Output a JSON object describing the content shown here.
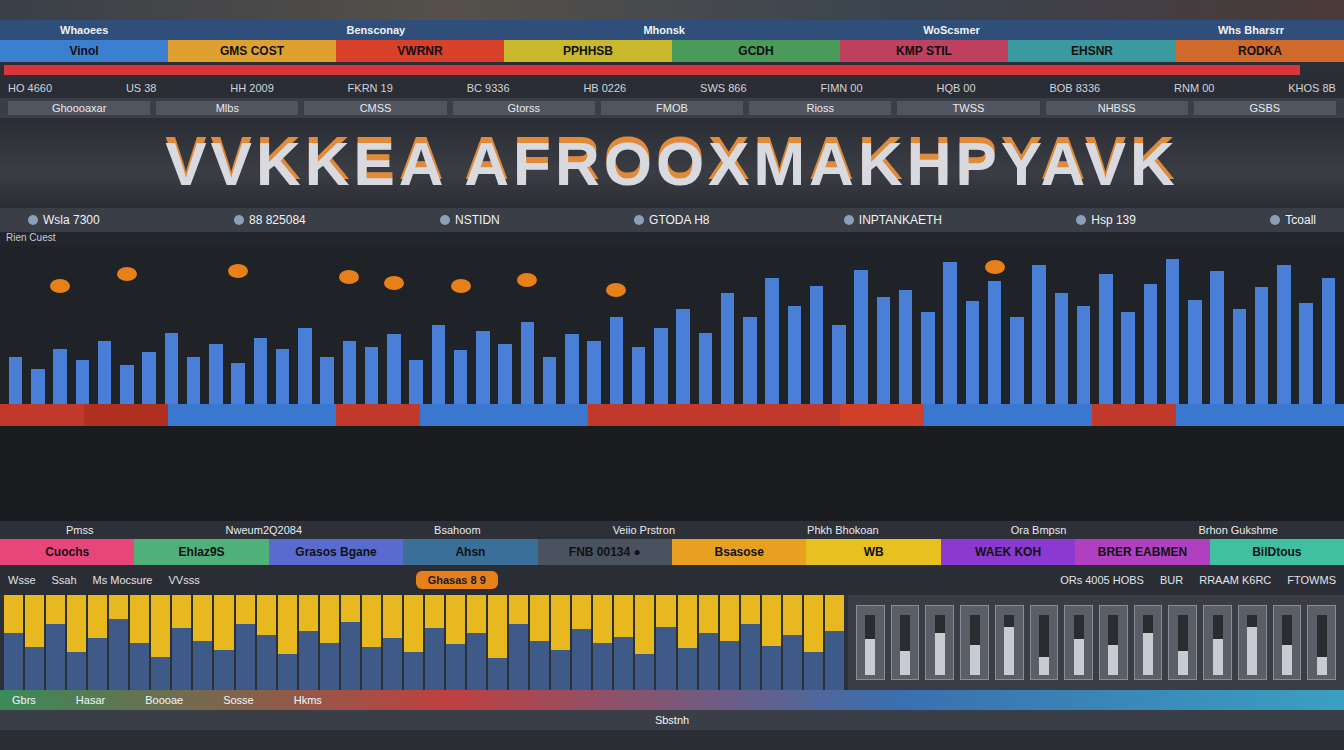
{
  "header": {
    "items": [
      "Whaoees",
      "Bensconay",
      "Mhonsk",
      "WoScsmer",
      "Whs Bharsrr"
    ]
  },
  "segments": [
    {
      "label": "Vinol",
      "color": "#3b7fd0"
    },
    {
      "label": "GMS COST",
      "color": "#e0a030"
    },
    {
      "label": "VWRNR",
      "color": "#d8402a"
    },
    {
      "label": "PPHHSB",
      "color": "#c9b82c"
    },
    {
      "label": "GCDH",
      "color": "#4a9a5a"
    },
    {
      "label": "KMP STIL",
      "color": "#c04060"
    },
    {
      "label": "EHSNR",
      "color": "#3a9aa0"
    },
    {
      "label": "RODKA",
      "color": "#d06a2a"
    }
  ],
  "progress": {
    "level": 0.97
  },
  "ticker": [
    "HO 4660",
    "US 38",
    "HH 2009",
    "FKRN 19",
    "BC 9336",
    "HB 0226",
    "SWS 866",
    "FIMN 00",
    "HQB 00",
    "BOB 8336",
    "RNM 00",
    "KHOS 8B"
  ],
  "toolbar": [
    "Ghoooaxar",
    "Mlbs",
    "CMSS",
    "Gtorss",
    "FMOB",
    "Rioss",
    "TWSS",
    "NHBSS",
    "GSBS"
  ],
  "banner": {
    "title": "VVKKEA AFROOXMAKHPYAVK"
  },
  "info": [
    "Wsla 7300",
    "88 825084",
    "NSTIDN",
    "GTODA H8",
    "INPTANKAETH",
    "Hsp 139",
    "Tcoall"
  ],
  "chart": {
    "label": "Rien Cuest",
    "bars": [
      30,
      22,
      35,
      28,
      40,
      25,
      33,
      45,
      30,
      38,
      26,
      42,
      35,
      48,
      30,
      40,
      36,
      44,
      28,
      50,
      34,
      46,
      38,
      52,
      30,
      44,
      40,
      55,
      36,
      48,
      60,
      45,
      70,
      55,
      80,
      62,
      75,
      50,
      85,
      68,
      72,
      58,
      90,
      65,
      78,
      55,
      88,
      70,
      62,
      82,
      58,
      76,
      92,
      66,
      84,
      60,
      74,
      88,
      64,
      80
    ],
    "peaks": [
      0,
      0,
      70,
      0,
      0,
      78,
      0,
      0,
      0,
      0,
      80,
      0,
      0,
      0,
      0,
      76,
      0,
      72,
      0,
      0,
      70,
      0,
      0,
      74,
      0,
      0,
      0,
      68,
      0,
      0,
      0,
      0,
      0,
      0,
      0,
      0,
      0,
      0,
      0,
      0,
      0,
      0,
      0,
      0,
      82,
      0,
      0,
      0,
      0,
      0,
      0,
      0,
      0,
      0,
      0,
      0,
      0,
      0,
      0,
      0
    ]
  },
  "band": [
    {
      "color": "#c0392b"
    },
    {
      "color": "#b03020"
    },
    {
      "color": "#3a78d0"
    },
    {
      "color": "#3a78d0"
    },
    {
      "color": "#c0392b"
    },
    {
      "color": "#3a78d0"
    },
    {
      "color": "#3a78d0"
    },
    {
      "color": "#c0392b"
    },
    {
      "color": "#c0392b"
    },
    {
      "color": "#c0392b"
    },
    {
      "color": "#d04028"
    },
    {
      "color": "#3a78d0"
    },
    {
      "color": "#3a78d0"
    },
    {
      "color": "#c0392b"
    },
    {
      "color": "#3a78d0"
    },
    {
      "color": "#3a78d0"
    }
  ],
  "columns": [
    "Pmss",
    "Nweum2Q2084",
    "Bsahoom",
    "Veiio Prstron",
    "Phkh Bhokoan",
    "Ora Bmpsn",
    "Brhon Gukshme"
  ],
  "tags": [
    {
      "label": "Cuochs",
      "color": "#e8457a"
    },
    {
      "label": "Ehlaz9S",
      "color": "#4fb07a"
    },
    {
      "label": "Grasos Bgane",
      "color": "#5a6bd0"
    },
    {
      "label": "Ahsn",
      "color": "#3a6f9a"
    },
    {
      "label": "FNB 00134 ●",
      "color": "#4a5260"
    },
    {
      "label": "Bsasose",
      "color": "#e8a020"
    },
    {
      "label": "WB",
      "color": "#e8c020"
    },
    {
      "label": "WAEK KOH",
      "color": "#8a3ad0"
    },
    {
      "label": "BRER EABMEN",
      "color": "#b040c0"
    },
    {
      "label": "BilDtous",
      "color": "#40c0a0"
    }
  ],
  "subrow": [
    "Wsse",
    "Ssah",
    "Ms Mocsure",
    "VVsss"
  ],
  "pill": {
    "label": "Ghasas 8 9"
  },
  "subrow_right": [
    "ORs 4005 HOBS",
    "BUR",
    "RRAAM K6RC",
    "FTOWMS"
  ],
  "lower_chart": {
    "values": [
      40,
      55,
      30,
      60,
      45,
      25,
      50,
      65,
      35,
      48,
      58,
      30,
      42,
      62,
      38,
      50,
      28,
      55,
      45,
      60,
      35,
      52,
      40,
      66,
      30,
      48,
      58,
      36,
      50,
      44,
      62,
      34,
      56,
      40,
      48,
      30,
      54,
      42,
      60,
      38
    ]
  },
  "rack": {
    "units": [
      0.6,
      0.4,
      0.7,
      0.5,
      0.8,
      0.3,
      0.6,
      0.5,
      0.7,
      0.4,
      0.6,
      0.8,
      0.5,
      0.3
    ]
  },
  "footer": [
    {
      "items": [
        "Gbrs",
        "Hasar",
        "Boooae",
        "Sosse",
        "Hkms"
      ]
    },
    {
      "items": [
        "Sbstnh"
      ]
    }
  ]
}
